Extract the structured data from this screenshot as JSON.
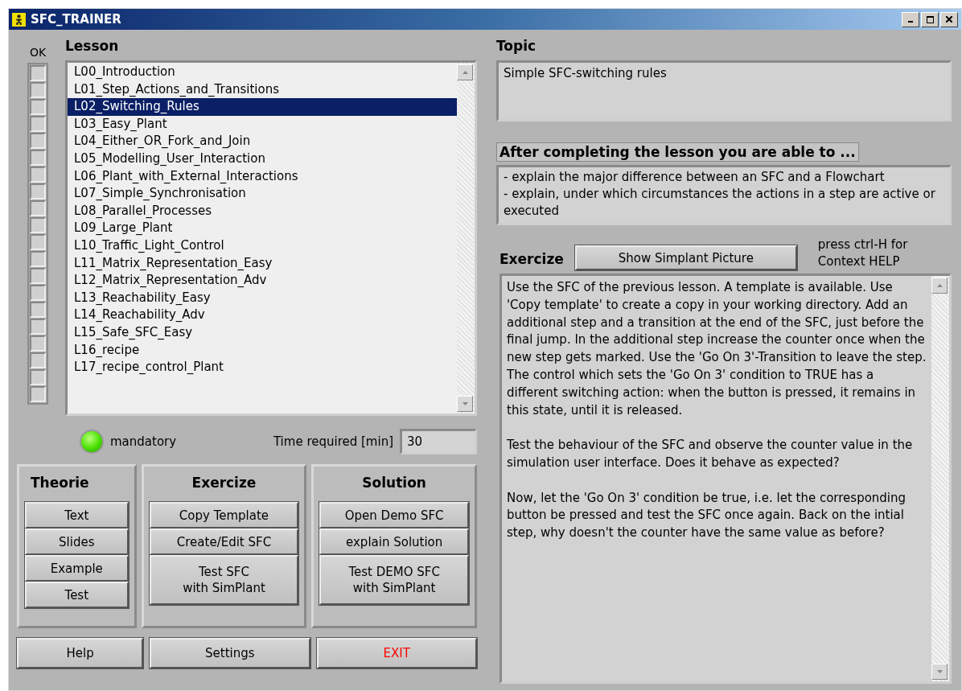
{
  "window": {
    "title": "SFC_TRAINER"
  },
  "ok_column": {
    "label": "OK",
    "checks": [
      {
        "checked": false
      },
      {
        "checked": false
      },
      {
        "checked": false
      },
      {
        "checked": false
      },
      {
        "checked": false
      },
      {
        "checked": false
      },
      {
        "checked": false
      },
      {
        "checked": false
      },
      {
        "checked": false
      },
      {
        "checked": false
      },
      {
        "checked": false
      },
      {
        "checked": false
      },
      {
        "checked": false
      },
      {
        "checked": false
      },
      {
        "checked": false
      },
      {
        "checked": false
      },
      {
        "checked": false
      },
      {
        "checked": false
      },
      {
        "checked": false
      },
      {
        "checked": false
      }
    ]
  },
  "lesson": {
    "label": "Lesson",
    "items": [
      {
        "label": "L00_Introduction",
        "selected": false
      },
      {
        "label": "L01_Step_Actions_and_Transitions",
        "selected": false
      },
      {
        "label": "L02_Switching_Rules",
        "selected": true
      },
      {
        "label": "L03_Easy_Plant",
        "selected": false
      },
      {
        "label": "L04_Either_OR_Fork_and_Join",
        "selected": false
      },
      {
        "label": "L05_Modelling_User_Interaction",
        "selected": false
      },
      {
        "label": "L06_Plant_with_External_Interactions",
        "selected": false
      },
      {
        "label": "L07_Simple_Synchronisation",
        "selected": false
      },
      {
        "label": "L08_Parallel_Processes",
        "selected": false
      },
      {
        "label": "L09_Large_Plant",
        "selected": false
      },
      {
        "label": "L10_Traffic_Light_Control",
        "selected": false
      },
      {
        "label": "L11_Matrix_Representation_Easy",
        "selected": false
      },
      {
        "label": "L12_Matrix_Representation_Adv",
        "selected": false
      },
      {
        "label": "L13_Reachability_Easy",
        "selected": false
      },
      {
        "label": "L14_Reachability_Adv",
        "selected": false
      },
      {
        "label": "L15_Safe_SFC_Easy",
        "selected": false
      },
      {
        "label": "L16_recipe",
        "selected": false
      },
      {
        "label": "L17_recipe_control_Plant",
        "selected": false
      }
    ]
  },
  "mandatory": {
    "label": "mandatory",
    "on": true
  },
  "time_required": {
    "label": "Time required [min]",
    "value": "30"
  },
  "groups": [
    {
      "title": "Theorie",
      "buttons": [
        "Text",
        "Slides",
        "Example",
        "Test"
      ]
    },
    {
      "title": "Exercize",
      "buttons": [
        "Copy Template",
        "Create/Edit SFC",
        "Test SFC\nwith SimPlant"
      ]
    },
    {
      "title": "Solution",
      "buttons": [
        "Open Demo SFC",
        "explain Solution",
        "Test DEMO SFC\nwith SimPlant"
      ]
    }
  ],
  "bottom_buttons": [
    {
      "label": "Help",
      "kind": "normal"
    },
    {
      "label": "Settings",
      "kind": "normal"
    },
    {
      "label": "EXIT",
      "kind": "exit"
    }
  ],
  "topic": {
    "label": "Topic",
    "value": "Simple SFC-switching rules"
  },
  "outcomes": {
    "label": "After completing the lesson you are able to ...",
    "value": "- explain the major difference between an SFC and a Flowchart\n- explain, under which circumstances the actions in a step are active or executed"
  },
  "exercize": {
    "label": "Exercize",
    "button": "Show Simplant Picture",
    "hint": "press ctrl-H for\nContext HELP",
    "text": "Use the SFC of the previous lesson. A template is available. Use 'Copy template' to create a copy in your working directory. Add an additional step and a transition at the end of the SFC, just before the final jump. In the additional step increase the counter once when the new step gets marked. Use the 'Go On 3'-Transition to leave the step.\nThe control which sets the 'Go On 3' condition to TRUE has a different switching action: when the button is pressed, it remains in this state, until it is released.\n\nTest the behaviour of the SFC and observe the counter value in the simulation user interface. Does it behave as expected?\n\nNow, let the 'Go On 3' condition be true, i.e. let the corresponding button be pressed and test the SFC once again. Back on the intial step, why doesn't  the counter have the same value as before?"
  }
}
